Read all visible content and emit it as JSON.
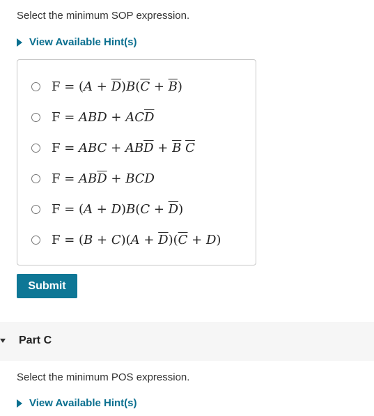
{
  "part_b": {
    "prompt": "Select the minimum SOP expression.",
    "hint_label": "View Available Hint(s)",
    "options": [
      {
        "expression": "F = (A + D̄)B(C̄ + B̄)"
      },
      {
        "expression": "F = ABD + ACD̄"
      },
      {
        "expression": "F = ABC + ABD̄ + B̄ C̄"
      },
      {
        "expression": "F = ABD̄ + BCD"
      },
      {
        "expression": "F = (A + D)B(C + D̄)"
      },
      {
        "expression": "F = (B + C)(A + D̄)(C̄ + D)"
      }
    ],
    "submit_label": "Submit"
  },
  "part_c": {
    "title": "Part C",
    "prompt": "Select the minimum POS expression.",
    "hint_label": "View Available Hint(s)"
  },
  "colors": {
    "accent": "#0a6f8f",
    "submit_bg": "#0e7796",
    "part_bar_bg": "#f6f6f6",
    "border": "#c7c7c7"
  }
}
